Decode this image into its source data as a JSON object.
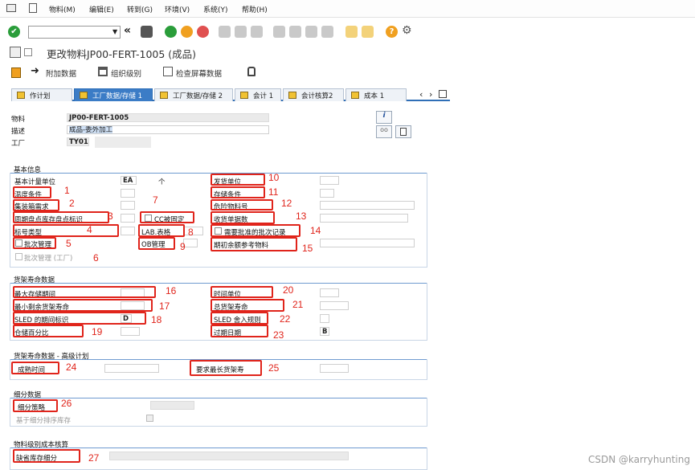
{
  "menu": {
    "items": [
      "物料(M)",
      "编辑(E)",
      "转到(G)",
      "环境(V)",
      "系统(Y)",
      "帮助(H)"
    ]
  },
  "title": "更改物料JP00-FERT-1005 (成品)",
  "appbar": {
    "items": [
      "附加数据",
      "组织级别",
      "检查屏幕数据"
    ]
  },
  "tabs": [
    "作计划",
    "工厂数据/存储 1",
    "工厂数据/存储 2",
    "会计 1",
    "会计核算2",
    "成本 1"
  ],
  "header": {
    "material_label": "物料",
    "material_value": "JP00-FERT-1005",
    "desc_label": "描述",
    "desc_value": "成品-委外加工",
    "plant_label": "工厂",
    "plant_value": "TY01"
  },
  "sections": {
    "basic": "基本信息",
    "shelf": "货架寿命数据",
    "shelf_adv": "货架寿命数据 - 高级计划",
    "subdiv": "细分数据",
    "costing": "物料级别成本核算"
  },
  "basic": {
    "base_uom_label": "基本计量单位",
    "base_uom_value": "EA",
    "base_uom_text": "个",
    "temp": "温度条件",
    "container": "集装箱需求",
    "cycle": "周期盘点库存盘点标识",
    "label_type": "标号类型",
    "batch": "批次管理",
    "batch_plant": "批次管理 (工厂)",
    "cc_fixed": "CC被固定",
    "lab": "LAB.表格",
    "ob": "OB管理",
    "issue_unit": "发货单位",
    "storage_cond": "存储条件",
    "hazmat": "危险物料号",
    "gr_days": "收货单据数",
    "approved_batch": "需要批准的批次记录",
    "init_batch_ref": "期初余额参考物料"
  },
  "shelf": {
    "max_storage": "最大存储期间",
    "min_shelf": "最小剩余货架寿命",
    "sled": "SLED 的期间标识",
    "sled_value": "D",
    "storage_pct": "仓储百分比",
    "time_unit": "时间单位",
    "total_shelf": "总货架寿命",
    "sled_round": "SLED 舍入规则",
    "expiry": "过期日期",
    "expiry_value": "B"
  },
  "shelf_adv": {
    "maturation": "成熟时间",
    "req_max_shelf": "要求最长货架寿"
  },
  "subdiv": {
    "strategy": "细分策略",
    "by_sorted": "基于细分排序库存"
  },
  "costing": {
    "default_stock_seg": "缺省库存细分"
  },
  "annotations": [
    "1",
    "2",
    "3",
    "4",
    "5",
    "6",
    "7",
    "8",
    "9",
    "10",
    "11",
    "12",
    "13",
    "14",
    "15",
    "16",
    "17",
    "18",
    "19",
    "20",
    "21",
    "22",
    "23",
    "24",
    "25",
    "26",
    "27"
  ],
  "watermark": "CSDN @karryhunting",
  "colors": {
    "accent": "#2f6fb7",
    "annotation": "#e0241b",
    "green_ok": "#2a9d3a"
  }
}
